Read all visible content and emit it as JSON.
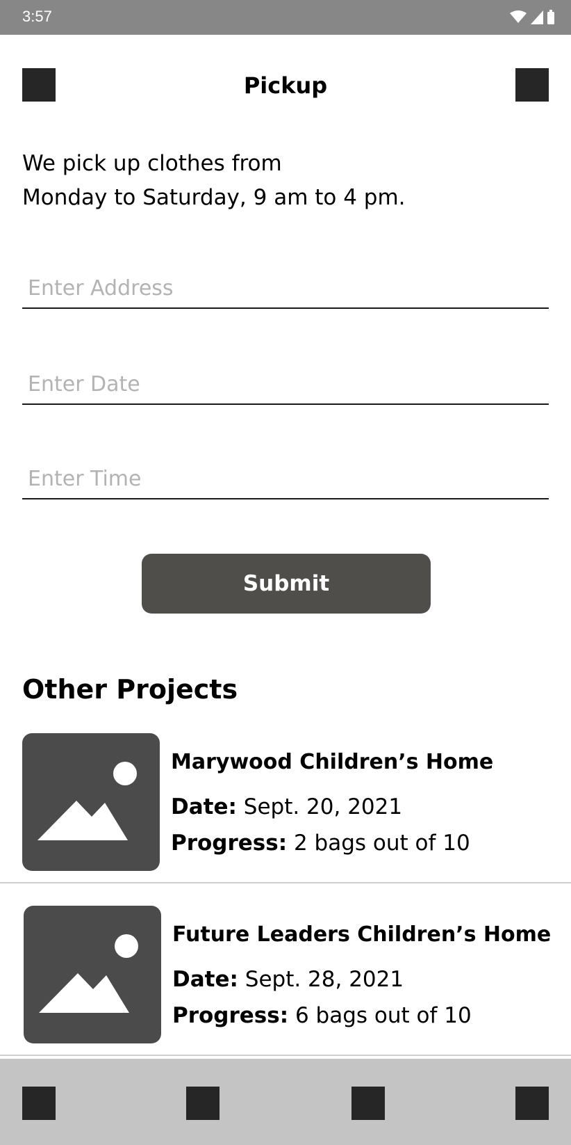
{
  "status_bar": {
    "time": "3:57",
    "icons": [
      "wifi-icon",
      "signal-icon",
      "battery-icon"
    ]
  },
  "app_bar": {
    "title": "Pickup",
    "left_icon": "menu-placeholder-icon",
    "right_icon": "action-placeholder-icon"
  },
  "intro": {
    "line1": "We pick up clothes from",
    "line2": "Monday to Saturday, 9 am to 4 pm."
  },
  "form": {
    "address_placeholder": "Enter Address",
    "address_value": "",
    "date_placeholder": "Enter Date",
    "date_value": "",
    "time_placeholder": "Enter Time",
    "time_value": "",
    "submit_label": "Submit"
  },
  "other_projects": {
    "title": "Other Projects",
    "date_label": "Date:",
    "progress_label": "Progress:",
    "items": [
      {
        "name": "Marywood Children’s Home",
        "date": "Sept. 20, 2021",
        "progress": "2 bags out of 10",
        "image_icon": "image-placeholder-icon"
      },
      {
        "name": "Future Leaders Children’s Home",
        "date": "Sept. 28, 2021",
        "progress": "6 bags out of 10",
        "image_icon": "image-placeholder-icon"
      }
    ]
  },
  "bottom_nav": {
    "items": [
      "nav-placeholder-icon",
      "nav-placeholder-icon",
      "nav-placeholder-icon",
      "nav-placeholder-icon"
    ]
  },
  "colors": {
    "status_bar": "#878787",
    "button": "#4f4e4b",
    "thumbnail": "#4a4b4a",
    "bottom_nav": "#c4c4c4",
    "placeholder_text": "#b3b3b3"
  }
}
